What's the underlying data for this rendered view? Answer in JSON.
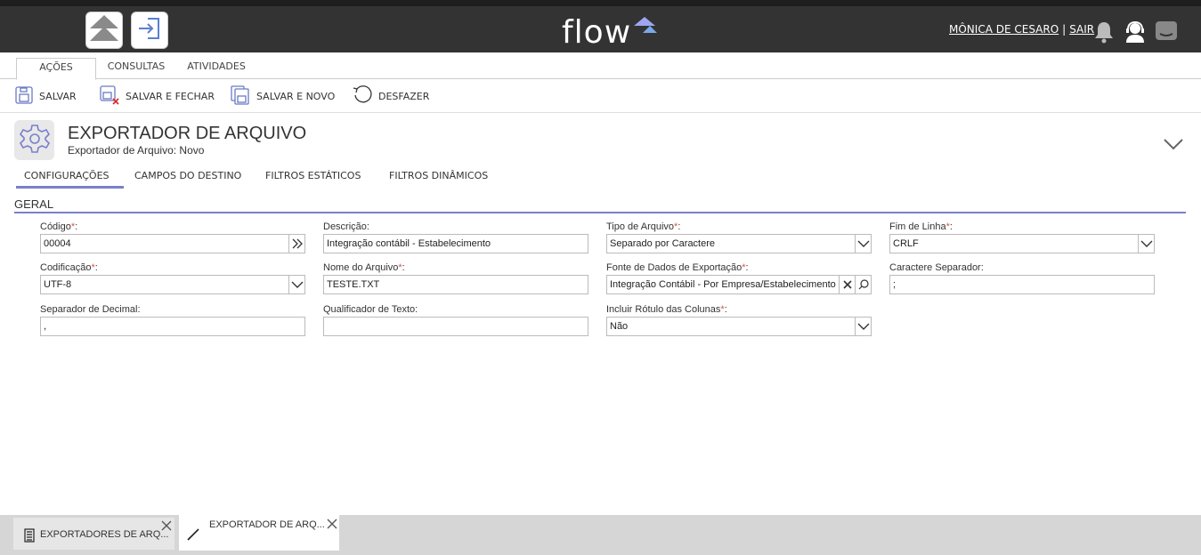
{
  "brand": {
    "logo_text": "flow"
  },
  "topbar": {
    "user_name": "MÔNICA DE CESARO",
    "separator": "|",
    "logout": "SAIR"
  },
  "ribbon": {
    "tabs": [
      "AÇÕES",
      "CONSULTAS",
      "ATIVIDADES"
    ]
  },
  "toolbar": {
    "save": "SALVAR",
    "save_close": "SALVAR E FECHAR",
    "save_new": "SALVAR E NOVO",
    "undo": "DESFAZER"
  },
  "header": {
    "title": "EXPORTADOR DE ARQUIVO",
    "subtitle": "Exportador de Arquivo: Novo"
  },
  "section_tabs": [
    "CONFIGURAÇÕES",
    "CAMPOS DO DESTINO",
    "FILTROS ESTÁTICOS",
    "FILTROS DINÂMICOS"
  ],
  "group": {
    "title": "GERAL"
  },
  "fields": {
    "codigo": {
      "label": "Código",
      "value": "00004"
    },
    "descricao": {
      "label": "Descrição:",
      "value": "Integração contábil - Estabelecimento"
    },
    "tipo_arquivo": {
      "label": "Tipo de Arquivo",
      "value": "Separado por Caractere"
    },
    "fim_linha": {
      "label": "Fim de Linha",
      "value": "CRLF"
    },
    "codificacao": {
      "label": "Codificação",
      "value": "UTF-8"
    },
    "nome_arquivo": {
      "label": "Nome do Arquivo",
      "value": "TESTE.TXT"
    },
    "fonte_dados": {
      "label": "Fonte de Dados de Exportação",
      "value": "Integração Contábil - Por Empresa/Estabelecimento"
    },
    "caractere_separador": {
      "label": "Caractere Separador:",
      "value": ";"
    },
    "separador_decimal": {
      "label": "Separador de Decimal:",
      "value": ","
    },
    "qualificador_texto": {
      "label": "Qualificador de Texto:",
      "value": ""
    },
    "incluir_rotulo": {
      "label": "Incluir Rótulo das Colunas",
      "value": "Não"
    }
  },
  "required_marker": "*",
  "colon": ":",
  "bottom_tabs": [
    "EXPORTADORES DE ARQ...",
    "EXPORTADOR DE ARQ..."
  ],
  "colors": {
    "accent": "#7a7fce",
    "topbar": "#333333",
    "required": "#d9534f"
  }
}
